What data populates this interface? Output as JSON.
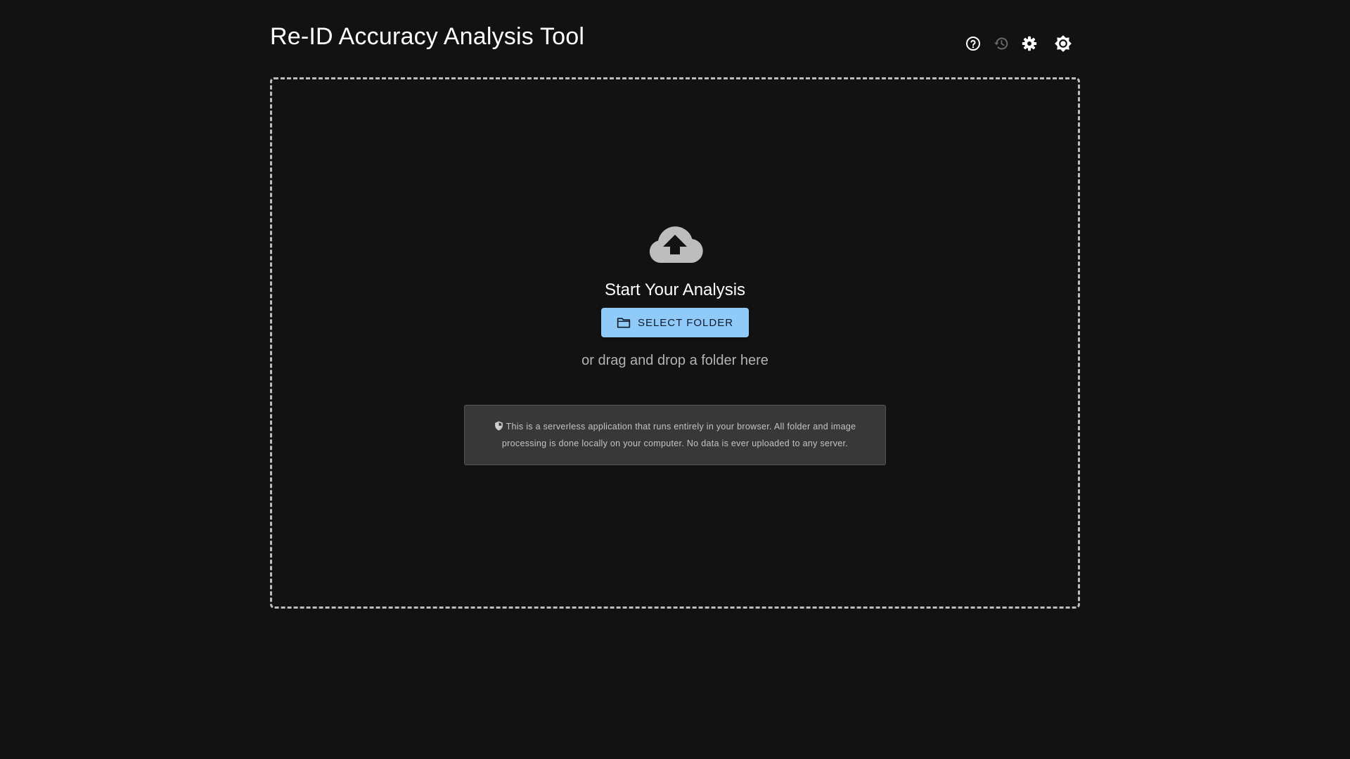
{
  "app": {
    "title": "Re-ID Accuracy Analysis Tool"
  },
  "toolbar": {
    "items": [
      {
        "name": "help",
        "icon": "help-circle-icon"
      },
      {
        "name": "history",
        "icon": "history-icon",
        "state": "disabled"
      },
      {
        "name": "settings",
        "icon": "gear-icon"
      },
      {
        "name": "theme",
        "icon": "brightness-icon"
      }
    ]
  },
  "dropzone": {
    "icon": "cloud-upload-icon",
    "heading": "Start Your Analysis",
    "select_button": "Select Folder",
    "select_button_icon": "folder-icon",
    "drag_hint": "or drag and drop a folder here",
    "privacy_icon": "shield-icon",
    "privacy_text": "This is a serverless application that runs entirely in your browser. All folder and image processing is done locally on your computer. No data is ever uploaded to any server."
  },
  "colors": {
    "background": "#121212",
    "accent": "#90caf9",
    "dropzone_border": "#bdbdbd",
    "notice_background": "#383838"
  }
}
